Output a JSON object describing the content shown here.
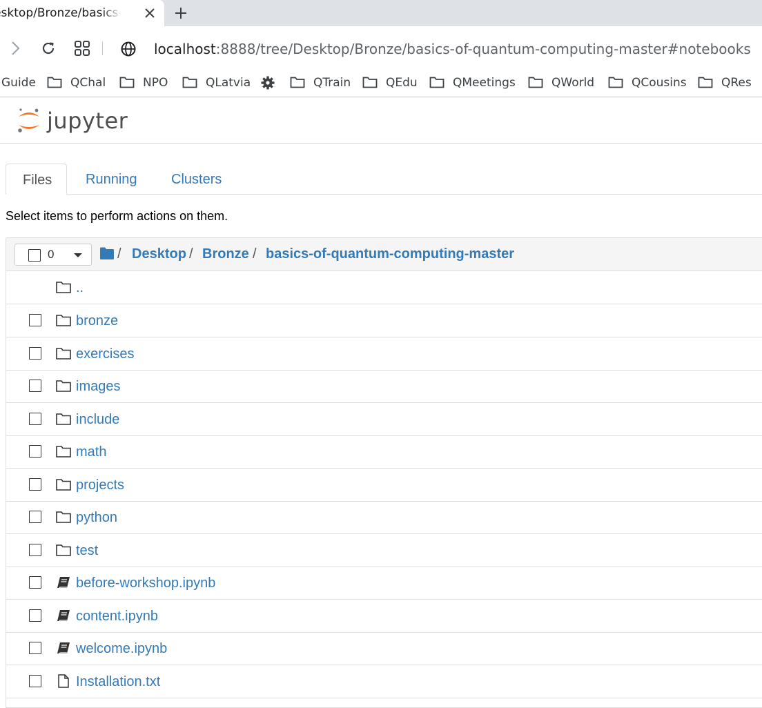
{
  "browser": {
    "tab_title": "Desktop/Bronze/basics-of-quantum-computing-master",
    "url_host": "localhost",
    "url_rest": ":8888/tree/Desktop/Bronze/basics-of-quantum-computing-master#notebooks",
    "bookmarks": [
      "Guide",
      "QChal",
      "NPO",
      "QLatvia",
      "QTrain",
      "QEdu",
      "QMeetings",
      "QWorld",
      "QCousins",
      "QRes"
    ]
  },
  "jupyter": {
    "logo_text": "jupyter",
    "tabs": [
      "Files",
      "Running",
      "Clusters"
    ],
    "hint": "Select items to perform actions on them.",
    "selected_count": "0",
    "breadcrumb": [
      "Desktop",
      "Bronze",
      "basics-of-quantum-computing-master"
    ],
    "parent_dir": "..",
    "items": [
      {
        "name": "bronze",
        "kind": "folder"
      },
      {
        "name": "exercises",
        "kind": "folder"
      },
      {
        "name": "images",
        "kind": "folder"
      },
      {
        "name": "include",
        "kind": "folder"
      },
      {
        "name": "math",
        "kind": "folder"
      },
      {
        "name": "projects",
        "kind": "folder"
      },
      {
        "name": "python",
        "kind": "folder"
      },
      {
        "name": "test",
        "kind": "folder"
      },
      {
        "name": "before-workshop.ipynb",
        "kind": "notebook"
      },
      {
        "name": "content.ipynb",
        "kind": "notebook"
      },
      {
        "name": "welcome.ipynb",
        "kind": "notebook"
      },
      {
        "name": "Installation.txt",
        "kind": "file"
      }
    ]
  },
  "colors": {
    "link": "#337ab7",
    "jupyter_orange": "#f37726",
    "tabstrip": "#dee1e6"
  }
}
